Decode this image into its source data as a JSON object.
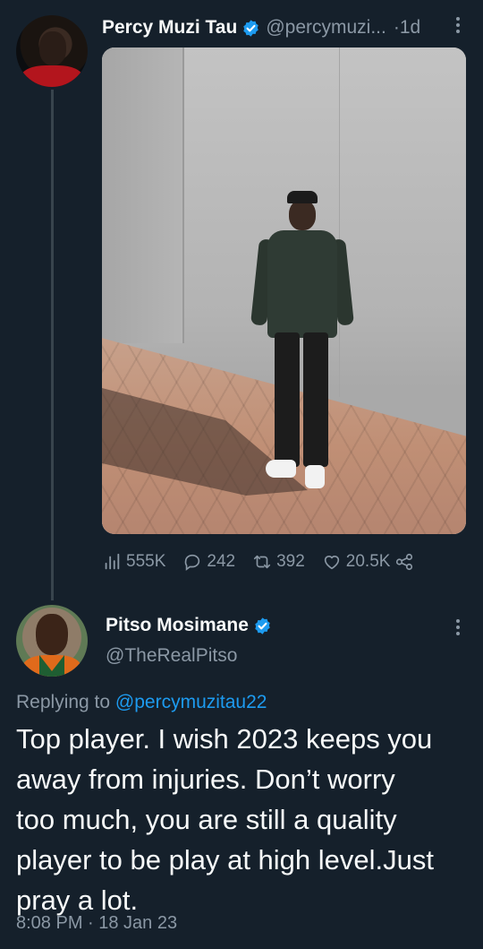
{
  "original_tweet": {
    "author_name": "Percy Muzi Tau",
    "author_handle": "@percymuzi...",
    "separator": "·",
    "time_ago": "1d",
    "stats": {
      "views": "555K",
      "replies": "242",
      "retweets": "392",
      "likes": "20.5K"
    }
  },
  "reply_tweet": {
    "author_name": "Pitso Mosimane",
    "author_handle": "@TheRealPitso",
    "replying_prefix": "Replying to",
    "replying_to": "@percymuzitau22",
    "text_lines": [
      "Top player. I wish 2023 keeps you",
      "away from injuries. Don’t worry",
      "too much, you are still a quality",
      "player to be play at high level.Just",
      "pray a lot."
    ],
    "timestamp": "8:08 PM · 18 Jan 23"
  },
  "colors": {
    "background": "#15202b",
    "primary_text": "#f7f9f9",
    "secondary_text": "#8b98a5",
    "link": "#1d9bf0",
    "verified": "#1d9bf0",
    "thread_line": "#38444d"
  },
  "icons": {
    "views": "bar-chart-icon",
    "replies": "speech-bubble-icon",
    "retweets": "retweet-icon",
    "likes": "heart-icon",
    "share": "share-icon",
    "verified": "verified-badge-icon",
    "more": "more-vertical-icon"
  }
}
